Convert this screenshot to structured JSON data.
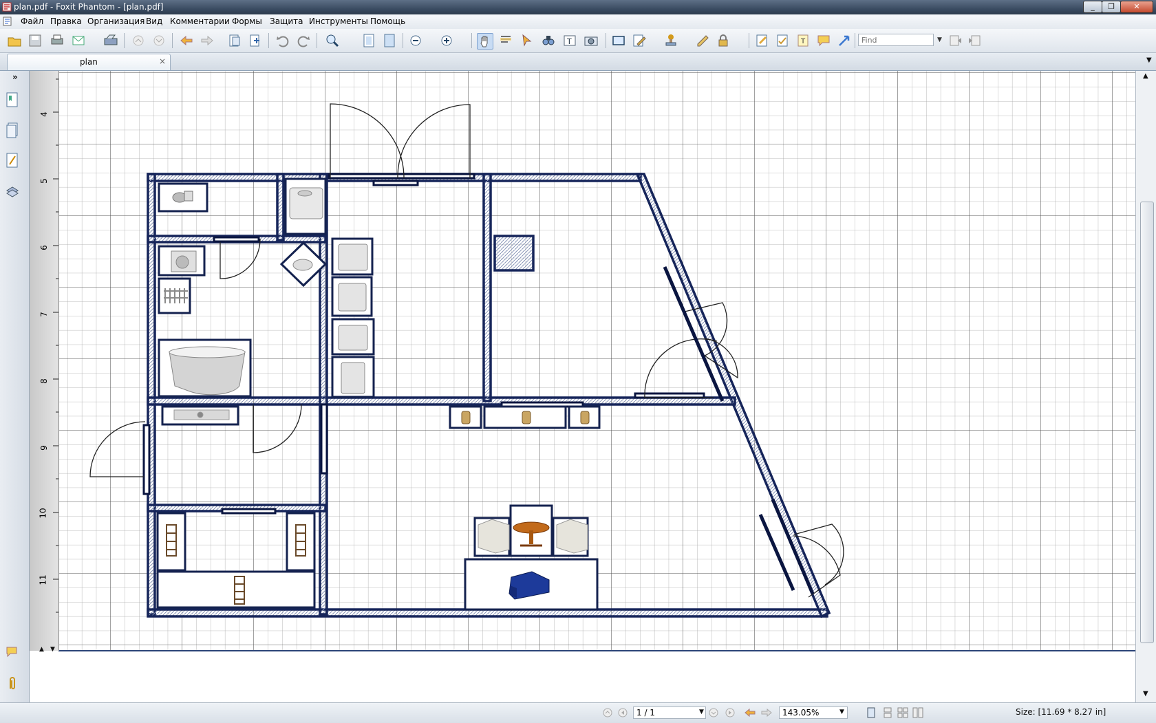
{
  "window": {
    "title": "plan.pdf - Foxit Phantom - [plan.pdf]",
    "controls": [
      "minimize",
      "maximize",
      "close"
    ]
  },
  "menu": [
    "Файл",
    "Правка",
    "Организация",
    "Вид",
    "Комментарии",
    "Формы",
    "Защита",
    "Инструменты",
    "Помощь"
  ],
  "toolbar": {
    "find_placeholder": "Find",
    "icons": [
      "open-icon",
      "save-icon",
      "print-icon",
      "email-icon",
      "scan-icon",
      "prev-page-icon",
      "next-page-icon",
      "back-icon",
      "forward-icon",
      "undo-icon",
      "redo-icon",
      "zoom-icon",
      "fit-page-icon",
      "fit-width-icon",
      "zoom-out-icon",
      "zoom-in-icon",
      "hand-tool-icon",
      "select-text-icon",
      "select-icon",
      "find-icon",
      "typewriter-icon",
      "snapshot-icon",
      "rectangle-icon",
      "edit-icon",
      "stamp-icon",
      "sign-icon",
      "lock-icon",
      "highlight-icon",
      "note-icon",
      "textbox-icon",
      "comment-icon",
      "arrow-icon"
    ]
  },
  "tab": {
    "label": "plan",
    "close": "×"
  },
  "sidepanel": {
    "expand": "»",
    "icons": [
      "bookmarks-icon",
      "pages-icon",
      "layers-icon",
      "attachments-panel-icon",
      "comments-icon",
      "paperclip-icon"
    ]
  },
  "ruler": {
    "numbers": [
      "4",
      "5",
      "6",
      "7",
      "8",
      "9",
      "10",
      "11"
    ]
  },
  "status": {
    "page": "1 / 1",
    "zoom": "143.05%",
    "size": "Size: [11.69 * 8.27 in]"
  },
  "colors": {
    "wall": "#1a2a5a",
    "grid": "#9a9a9a",
    "accent": "#2b5ba8"
  }
}
